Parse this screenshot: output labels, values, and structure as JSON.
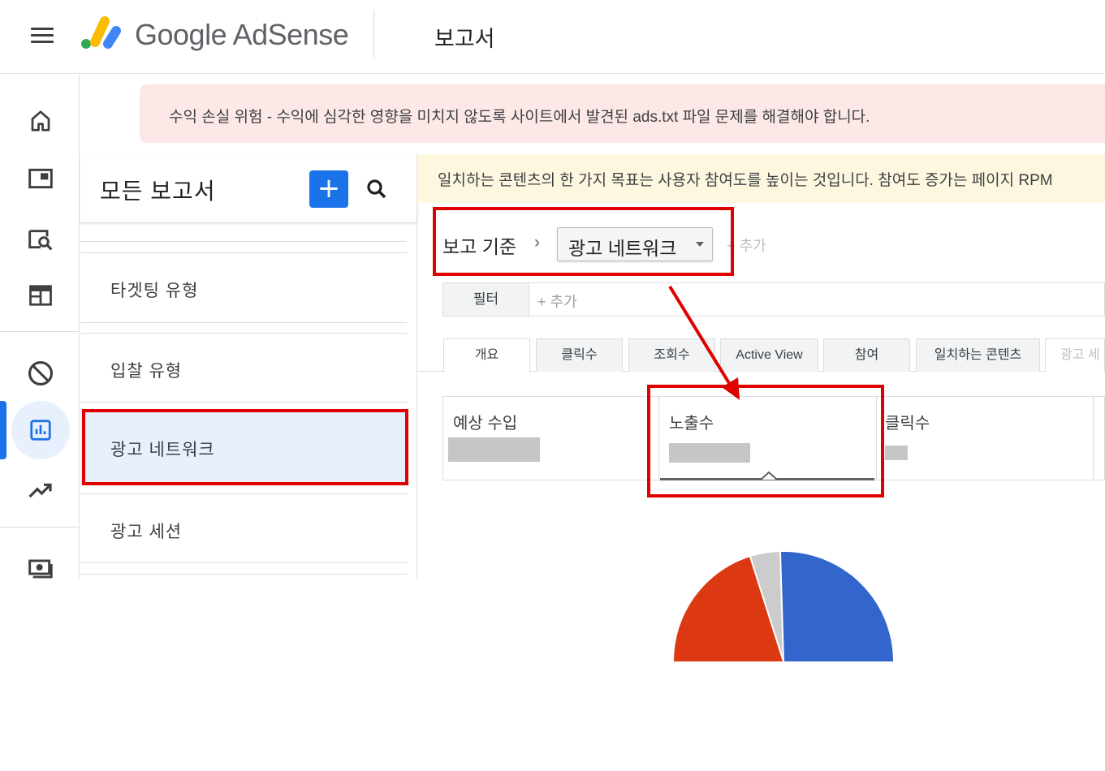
{
  "header": {
    "brand_text": "Google AdSense",
    "page_title": "보고서"
  },
  "rail": {
    "icons": [
      "home-icon",
      "ad-unit-icon",
      "site-search-icon",
      "layout-icon",
      "block-icon",
      "report-icon",
      "trending-icon",
      "payments-icon"
    ],
    "active": "report-icon"
  },
  "alert": {
    "text": "수익 손실 위험 - 수익에 심각한 영향을 미치지 않도록 사이트에서 발견된 ads.txt 파일 문제를 해결해야 합니다."
  },
  "reports": {
    "title": "모든 보고서",
    "add_label": "+",
    "items": [
      {
        "label": "타겟팅 유형"
      },
      {
        "label": "입찰 유형"
      },
      {
        "label": "광고 네트워크"
      },
      {
        "label": "광고 세션"
      }
    ],
    "selected": "광고 네트워크"
  },
  "banner": {
    "text": "일치하는 콘텐츠의 한 가지 목표는 사용자 참여도를 높이는 것입니다. 참여도 증가는 페이지 RPM"
  },
  "report_basis": {
    "label": "보고 기준",
    "chevron": "›",
    "selected": "광고 네트워크",
    "add_label": "+ 추가"
  },
  "filter": {
    "button_label": "필터",
    "add_label": "+ 추가"
  },
  "tabs": [
    {
      "label": "개요"
    },
    {
      "label": "클릭수"
    },
    {
      "label": "조회수"
    },
    {
      "label": "Active View"
    },
    {
      "label": "참여"
    },
    {
      "label": "일치하는 콘텐츠"
    },
    {
      "label": "광고 세"
    }
  ],
  "active_tab": "개요",
  "metrics": [
    {
      "label": "예상 수입"
    },
    {
      "label": "노출수"
    },
    {
      "label": "클릭수"
    }
  ],
  "selected_metric": "노출수",
  "colors": {
    "accent": "#1a73e8",
    "highlight": "#e00000",
    "alert_bg": "#fce8e6",
    "banner_bg": "#fef7e0",
    "pie_blue": "#3366cc",
    "pie_red": "#dc3912",
    "pie_gray": "#cccccc"
  }
}
